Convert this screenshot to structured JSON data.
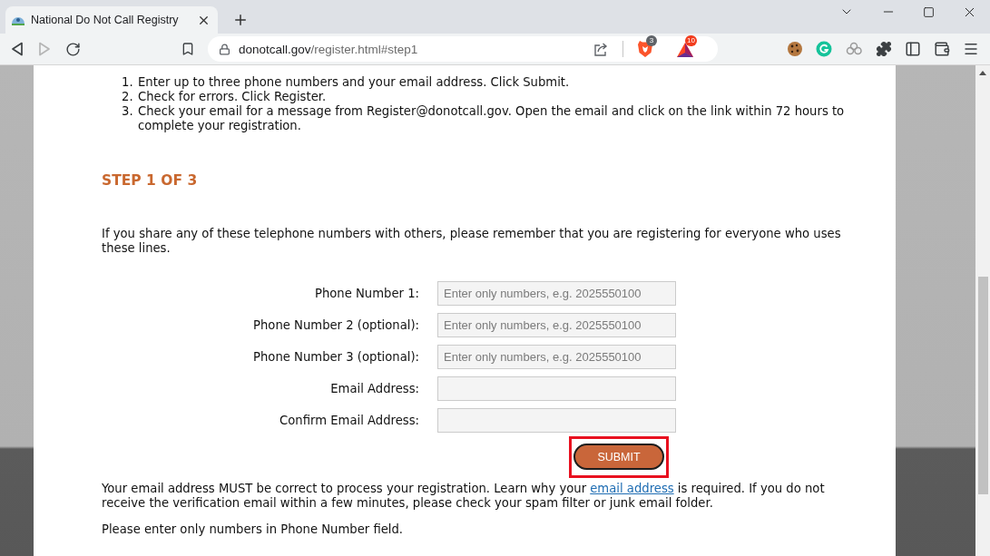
{
  "browser": {
    "tabs": [
      {
        "title": "National Do Not Call Registry",
        "selected": true
      }
    ],
    "nav": [
      {
        "kind": "back",
        "disabled": false
      },
      {
        "kind": "forward",
        "disabled": true
      },
      {
        "kind": "reload",
        "disabled": false
      }
    ],
    "address": {
      "host": "donotcall.gov",
      "path": "/register.html#step1"
    },
    "badges": [
      {
        "kind": "shield",
        "count": "3"
      },
      {
        "kind": "triangle",
        "count": "10"
      }
    ]
  },
  "page": {
    "steps": [
      {
        "number": "1.",
        "text": "Enter up to three phone numbers and your email address. Click Submit."
      },
      {
        "number": "2.",
        "text": "Check for errors. Click Register."
      },
      {
        "number": "3.",
        "text": "Check your email for a message from Register@donotcall.gov. Open the email and click on the link within 72 hours to complete your registration."
      }
    ],
    "heading": "STEP 1 OF 3",
    "intro": "If you share any of these telephone numbers with others, please remember that you are registering for everyone who uses these lines.",
    "form": {
      "fields": [
        {
          "label": "Phone Number 1:",
          "placeholder": "Enter only numbers, e.g. 2025550100"
        },
        {
          "label": "Phone Number 2 (optional):",
          "placeholder": "Enter only numbers, e.g. 2025550100"
        },
        {
          "label": "Phone Number 3 (optional):",
          "placeholder": "Enter only numbers, e.g. 2025550100"
        },
        {
          "label": "Email Address:"
        },
        {
          "label": "Confirm Email Address:"
        }
      ],
      "submit": {
        "label": "SUBMIT",
        "highlighted": true
      }
    },
    "notice": {
      "before": "Your email address MUST be correct to process your registration. Learn why your ",
      "link": "email address",
      "after": " is required. If you do not receive the verification email within a few minutes, please check your spam filter or junk email folder."
    },
    "note": "Please enter only numbers in Phone Number field."
  }
}
